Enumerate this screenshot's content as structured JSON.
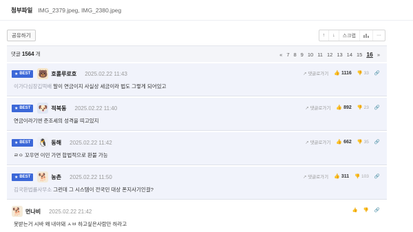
{
  "attachments": {
    "label": "첨부파일",
    "files": "IMG_2379.jpeg,  IMG_2380.jpeg"
  },
  "toolbar": {
    "share_label": "공유하기",
    "up_icon": "arrow-up-icon",
    "down_icon": "arrow-down-icon",
    "scrap_label": "스크랩",
    "stats_icon": "chart-icon",
    "more_icon": "more-icon"
  },
  "comments_header": {
    "prefix": "댓글",
    "count": "1564",
    "suffix": "개",
    "pager": {
      "prev": "«",
      "pages": [
        "7",
        "8",
        "9",
        "10",
        "11",
        "12",
        "13",
        "14",
        "15"
      ],
      "current": "16",
      "next": "»"
    }
  },
  "comments": [
    {
      "best": true,
      "badge": "BEST",
      "avatar_icon": "bear-avatar-icon",
      "nickname": "호롤루로호",
      "date": "2025.02.22 11:43",
      "tag": "이가다심장깁떡배",
      "text": "말이 연금이지 사실상 세금이라 법도 그렇게 되어있고",
      "reply_label": "댓글로가기",
      "upvotes": "1116",
      "downvotes": "33"
    },
    {
      "best": true,
      "badge": "BEST",
      "avatar_icon": "dog-avatar-icon",
      "nickname": "적북동",
      "date": "2025.02.22 11:40",
      "tag": "",
      "text": "연금이라기엔 준조세의 성격을 띠고있지",
      "reply_label": "댓글로가기",
      "upvotes": "892",
      "downvotes": "23"
    },
    {
      "best": true,
      "badge": "BEST",
      "avatar_icon": "bird-avatar-icon",
      "nickname": "동해",
      "date": "2025.02.22 11:42",
      "tag": "",
      "text": "ㄹㅇ 꼬우면 이민 가면 합법적으로 환불 가능",
      "reply_label": "댓글로가기",
      "upvotes": "662",
      "downvotes": "35"
    },
    {
      "best": true,
      "badge": "BEST",
      "avatar_icon": "puppy-avatar-icon",
      "nickname": "농촌",
      "date": "2025.02.22 11:50",
      "tag": "김국환법률사무소",
      "text": "그런데 그 시스템이 전국민 대상 폰지사기인걸?",
      "reply_label": "댓글로가기",
      "upvotes": "311",
      "downvotes": "103"
    },
    {
      "best": false,
      "badge": "",
      "avatar_icon": "puppy-avatar-icon",
      "nickname": "먼나비",
      "date": "2025.02.22 21:42",
      "tag": "",
      "text": "못받는거 시바 왜 내야돼 ㅅㅂ 하고싶은사람만 하라고",
      "reply_label": "",
      "upvotes": "",
      "downvotes": ""
    }
  ],
  "colors": {
    "best_badge": "#3c68d8",
    "best_bg": "#f1f3fb",
    "count_bar_bg": "#f4f5f9"
  }
}
